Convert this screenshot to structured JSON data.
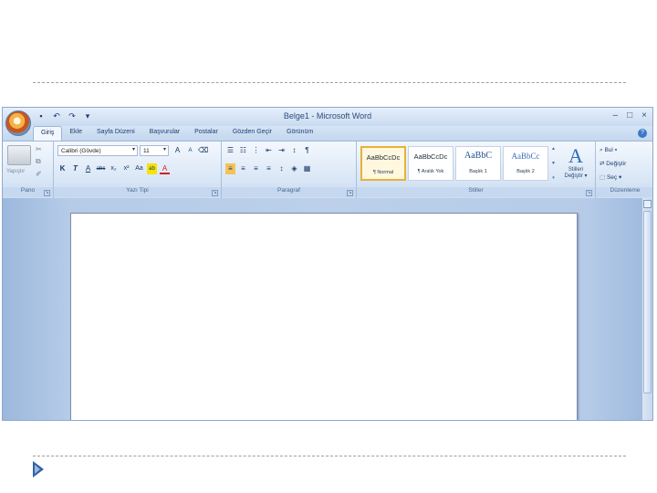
{
  "window": {
    "title": "Belge1 - Microsoft Word",
    "controls": [
      "–",
      "□",
      "×"
    ]
  },
  "quick_access": {
    "icons": [
      "save-icon",
      "undo-icon",
      "redo-icon",
      "customize-icon"
    ],
    "glyphs": [
      "▪",
      "↶",
      "↷",
      "▾"
    ]
  },
  "tabs": [
    {
      "label": "Giriş",
      "active": true
    },
    {
      "label": "Ekle"
    },
    {
      "label": "Sayfa Düzeni"
    },
    {
      "label": "Başvurular"
    },
    {
      "label": "Postalar"
    },
    {
      "label": "Gözden Geçir"
    },
    {
      "label": "Görünüm"
    }
  ],
  "help_glyph": "?",
  "ribbon": {
    "pano": {
      "label": "Pano",
      "paste_label": "Yapıştır",
      "launcher": "↘",
      "icon_glyphs": [
        "✂",
        "⧉",
        "✐"
      ]
    },
    "font": {
      "label": "Yazı Tipi",
      "font_name": "Calibri (Gövde)",
      "font_size": "11",
      "launcher": "↘",
      "row1": [
        "A",
        "A",
        "⌫"
      ],
      "row2": [
        "K",
        "T",
        "A",
        "abc",
        "x₂",
        "x²",
        "Aa",
        "ab",
        "A"
      ]
    },
    "paragraph": {
      "label": "Paragraf",
      "launcher": "↘",
      "row1": [
        "☰",
        "☷",
        "⋮",
        "⇤",
        "⇥",
        "↕",
        "¶"
      ],
      "row2": [
        "≡",
        "≡",
        "≡",
        "≡",
        "↕",
        "◈",
        "▦"
      ]
    },
    "styles": {
      "label": "Stiller",
      "launcher": "↘",
      "items": [
        {
          "sample": "AaBbCcDc",
          "name": "¶ Normal",
          "selected": true
        },
        {
          "sample": "AaBbCcDc",
          "name": "¶ Aralık Yok"
        },
        {
          "sample": "AaBbC",
          "name": "Başlık 1"
        },
        {
          "sample": "AaBbCc",
          "name": "Başlık 2"
        }
      ],
      "change_styles": {
        "glyph": "A",
        "line1": "Stilleri",
        "line2": "Değiştir ▾"
      },
      "scroll_glyphs": [
        "▲",
        "▼",
        "▾"
      ]
    },
    "editing": {
      "label": "Düzenleme",
      "find": "Bul ▾",
      "replace": "Değiştir",
      "select": "Seç ▾",
      "find_icon": "⌕",
      "replace_icon": "⇄",
      "select_icon": "⬚"
    }
  }
}
